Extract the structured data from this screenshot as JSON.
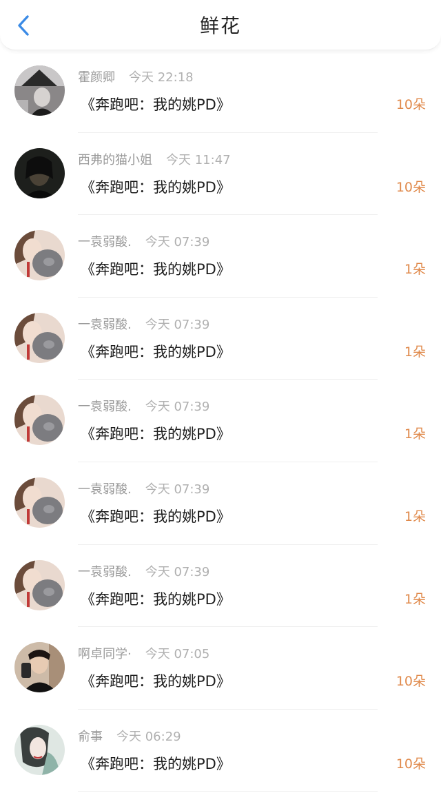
{
  "header": {
    "title": "鲜花",
    "back_icon": "chevron-left-icon",
    "accent_color": "#3b8be6"
  },
  "colors": {
    "count_color": "#e08a4c",
    "meta_color": "#9a9a9a"
  },
  "items": [
    {
      "name": "霍颜卿",
      "time": "今天 22:18",
      "gift": "《奔跑吧：我的姚PD》",
      "count": "10朵",
      "avatar": "avatar-dark-umbrella"
    },
    {
      "name": "西弗的猫小姐",
      "time": "今天 11:47",
      "gift": "《奔跑吧：我的姚PD》",
      "count": "10朵",
      "avatar": "avatar-dark-man"
    },
    {
      "name": "一袁弱酸.",
      "time": "今天 07:39",
      "gift": "《奔跑吧：我的姚PD》",
      "count": "1朵",
      "avatar": "avatar-girl-cat"
    },
    {
      "name": "一袁弱酸.",
      "time": "今天 07:39",
      "gift": "《奔跑吧：我的姚PD》",
      "count": "1朵",
      "avatar": "avatar-girl-cat"
    },
    {
      "name": "一袁弱酸.",
      "time": "今天 07:39",
      "gift": "《奔跑吧：我的姚PD》",
      "count": "1朵",
      "avatar": "avatar-girl-cat"
    },
    {
      "name": "一袁弱酸.",
      "time": "今天 07:39",
      "gift": "《奔跑吧：我的姚PD》",
      "count": "1朵",
      "avatar": "avatar-girl-cat"
    },
    {
      "name": "一袁弱酸.",
      "time": "今天 07:39",
      "gift": "《奔跑吧：我的姚PD》",
      "count": "1朵",
      "avatar": "avatar-girl-cat"
    },
    {
      "name": "啊卓同学·",
      "time": "今天 07:05",
      "gift": "《奔跑吧：我的姚PD》",
      "count": "10朵",
      "avatar": "avatar-selfie"
    },
    {
      "name": "俞事",
      "time": "今天 06:29",
      "gift": "《奔跑吧：我的姚PD》",
      "count": "10朵",
      "avatar": "avatar-illustration"
    }
  ]
}
